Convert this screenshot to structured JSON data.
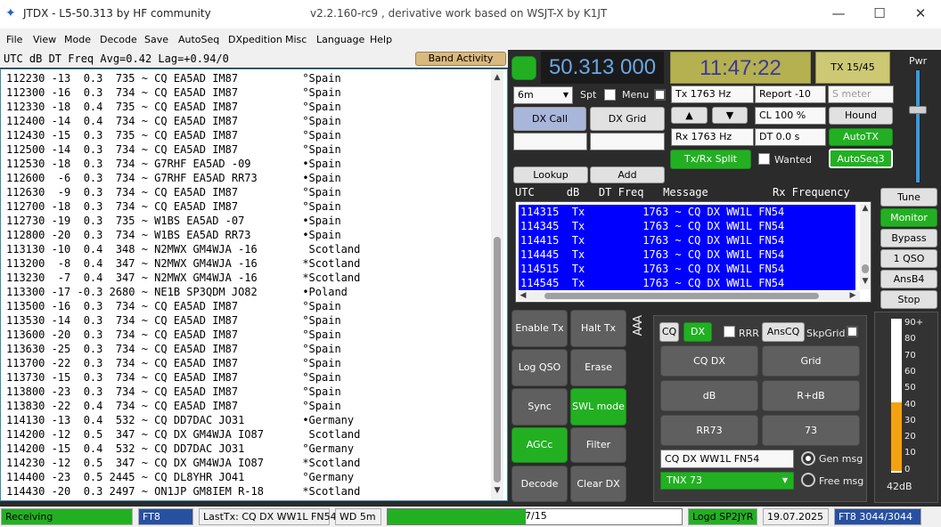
{
  "window": {
    "title": "JTDX - L5-50.313  by HF community",
    "subtitle": "v2.2.160-rc9 , derivative work based on WSJT-X by K1JT",
    "minimize": "—",
    "maximize": "☐",
    "close": "✕"
  },
  "menu": [
    "File",
    "View",
    "Mode",
    "Decode",
    "Save",
    "AutoSeq",
    "DXpedition",
    "Misc",
    "Language",
    "Help"
  ],
  "band_activity": {
    "header": "UTC    dB   DT Freq   Avg=0.42 Lag=+0.94/0",
    "button": "Band Activity",
    "rows": [
      "112230 -13  0.3  735 ~ CQ EA5AD IM87          °Spain",
      "112300 -16  0.3  734 ~ CQ EA5AD IM87          °Spain",
      "112330 -18  0.4  735 ~ CQ EA5AD IM87          °Spain",
      "112400 -14  0.4  734 ~ CQ EA5AD IM87          °Spain",
      "112430 -15  0.3  735 ~ CQ EA5AD IM87          °Spain",
      "112500 -14  0.3  734 ~ CQ EA5AD IM87          °Spain",
      "112530 -18  0.3  734 ~ G7RHF EA5AD -09        •Spain",
      "112600  -6  0.3  734 ~ G7RHF EA5AD RR73       •Spain",
      "112630  -9  0.3  734 ~ CQ EA5AD IM87          °Spain",
      "112700 -18  0.3  734 ~ CQ EA5AD IM87          °Spain",
      "112730 -19  0.3  735 ~ W1BS EA5AD -07         •Spain",
      "112800 -20  0.3  734 ~ W1BS EA5AD RR73        •Spain",
      "113130 -10  0.4  348 ~ N2MWX GM4WJA -16        Scotland",
      "113200  -8  0.4  347 ~ N2MWX GM4WJA -16       *Scotland",
      "113230  -7  0.4  347 ~ N2MWX GM4WJA -16       *Scotland",
      "113300 -17 -0.3 2680 ~ NE1B SP3QDM JO82       •Poland",
      "113500 -16  0.3  734 ~ CQ EA5AD IM87          °Spain",
      "113530 -14  0.3  734 ~ CQ EA5AD IM87          °Spain",
      "113600 -20  0.3  734 ~ CQ EA5AD IM87          °Spain",
      "113630 -25  0.3  734 ~ CQ EA5AD IM87          °Spain",
      "113700 -22  0.3  734 ~ CQ EA5AD IM87          °Spain",
      "113730 -15  0.3  734 ~ CQ EA5AD IM87          °Spain",
      "113800 -23  0.3  734 ~ CQ EA5AD IM87          °Spain",
      "113830 -22  0.4  734 ~ CQ EA5AD IM87          °Spain",
      "114130 -13  0.4  532 ~ CQ DD7DAC JO31         •Germany",
      "114200 -12  0.5  347 ~ CQ DX GM4WJA IO87       Scotland",
      "114200 -15  0.4  532 ~ CQ DD7DAC JO31         °Germany",
      "114230 -12  0.5  347 ~ CQ DX GM4WJA IO87      *Scotland",
      "114400 -23  0.5 2445 ~ CQ DL8YHR JO41         °Germany",
      "114430 -20  0.3 2497 ~ ON1JP GM8IEM R-18      *Scotland"
    ]
  },
  "controls": {
    "frequency": "50.313 000",
    "clock": "11:47:22",
    "tx_period": "TX 15/45",
    "band": "6m",
    "spt": "Spt",
    "menu": "Menu",
    "tx_hz": "Tx  1763  Hz",
    "rx_hz": "Rx  1763  Hz",
    "report": "Report -10",
    "s_meter": "S meter",
    "cl": "CL  100 %",
    "dt": "DT 0.0 s",
    "dx_call": "DX Call",
    "dx_grid": "DX Grid",
    "up": "▲",
    "down": "▼",
    "hound": "Hound",
    "autotx": "AutoTX",
    "tx_rx_split": "Tx/Rx Split",
    "wanted": "Wanted",
    "autoseq3": "AutoSeq3",
    "lookup": "Lookup",
    "add": "Add",
    "pwr": "Pwr"
  },
  "rx_frequency": {
    "header": "UTC     dB   DT Freq   Message          Rx Frequency",
    "rows": [
      "114315  Tx         1763 ~ CQ DX WW1L FN54",
      "114345  Tx         1763 ~ CQ DX WW1L FN54",
      "114415  Tx         1763 ~ CQ DX WW1L FN54",
      "114445  Tx         1763 ~ CQ DX WW1L FN54",
      "114515  Tx         1763 ~ CQ DX WW1L FN54",
      "114545  Tx         1763 ~ CQ DX WW1L FN54"
    ]
  },
  "side_buttons": [
    "Tune",
    "Monitor",
    "Bypass",
    "1 QSO",
    "AnsB4",
    "Stop"
  ],
  "action_buttons": {
    "enable_tx": "Enable Tx",
    "halt_tx": "Halt Tx",
    "log_qso": "Log QSO",
    "erase": "Erase",
    "sync": "Sync",
    "swl_mode": "SWL mode",
    "agcc": "AGCc",
    "filter": "Filter",
    "decode": "Decode",
    "clear_dx": "Clear DX",
    "tab_label": "AAA"
  },
  "tx_panel": {
    "cq": "CQ",
    "dx": "DX",
    "rrr": "RRR",
    "anscq": "AnsCQ",
    "skpgrid": "SkpGrid",
    "cq_dx": "CQ DX",
    "grid": "Grid",
    "db": "dB",
    "r_db": "R+dB",
    "rr73": "RR73",
    "b73": "73",
    "gen_input": "CQ DX WW1L FN54",
    "gen_msg": "Gen msg",
    "free_select": "TNX 73",
    "free_msg": "Free msg"
  },
  "meter": {
    "ticks": [
      "90+",
      "80",
      "70",
      "60",
      "50",
      "40",
      "30",
      "20",
      "10",
      "0"
    ],
    "value_label": "42dB",
    "level": 0.42
  },
  "status": {
    "receiving": "Receiving",
    "mode": "FT8",
    "last_tx": "LastTx: CQ DX WW1L FN54",
    "wd": "WD 5m",
    "progress_text": "7/15",
    "progress": 0.47,
    "logd": "Logd SP2JYR",
    "date": "19.07.2025",
    "ft8_count": "FT8  3044/3044"
  },
  "colors": {
    "green": "#22b022",
    "rx_highlight": "#0000ff",
    "clock_bg": "#b5b050",
    "freq_fg": "#6aa7e6"
  }
}
